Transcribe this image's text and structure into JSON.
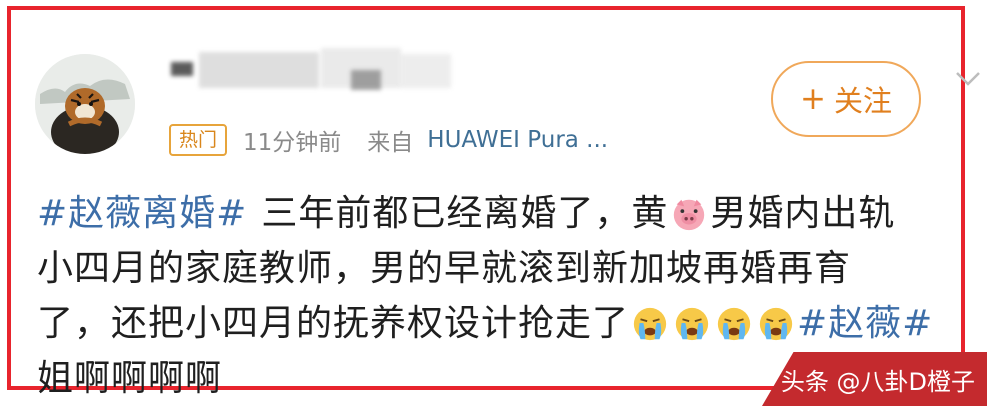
{
  "post": {
    "badge": "热门",
    "time": "11分钟前",
    "source_prefix": "来自",
    "device": "HUAWEI Pura ...",
    "follow_label": "关注",
    "follow_plus": "+",
    "hashtag_main": "#赵薇离婚#",
    "line1_a": "三年前都已经离婚了，黄",
    "line1_b": "男婚内出轨",
    "line2": "小四月的家庭教师，男的早就滚到新加坡再婚再育",
    "line3": "了，还把小四月的抚养权设计抢走了",
    "hashtag_tail": "#赵薇#",
    "line4": "姐啊啊啊啊"
  },
  "icons": {
    "emoji_pig": "pig-face-icon",
    "emoji_cry": "loudly-crying-face-icon",
    "chevron": "chevron-down-icon"
  },
  "colors": {
    "border": "#e8242d",
    "hashtag": "#3d6ea8",
    "follow": "#e07f1e",
    "badge": "#d9861b",
    "device": "#3f6f95"
  },
  "watermark": "头条 @八卦D橙子"
}
